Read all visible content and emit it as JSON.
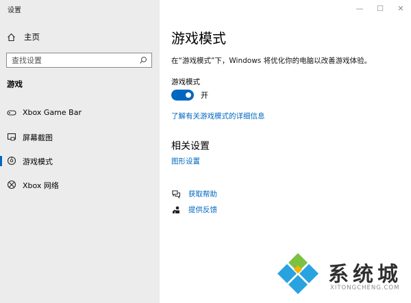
{
  "window": {
    "title": "设置",
    "controls": {
      "minimize": "—",
      "maximize": "☐",
      "close": "✕"
    }
  },
  "sidebar": {
    "home_label": "主页",
    "search_placeholder": "查找设置",
    "section_title": "游戏",
    "items": [
      {
        "label": "Xbox Game Bar",
        "icon": "xbox-game-bar-icon"
      },
      {
        "label": "屏幕截图",
        "icon": "screenshot-icon"
      },
      {
        "label": "游戏模式",
        "icon": "game-mode-icon",
        "active": true
      },
      {
        "label": "Xbox 网络",
        "icon": "xbox-icon"
      }
    ]
  },
  "main": {
    "title": "游戏模式",
    "description": "在“游戏模式”下，Windows 将优化你的电脑以改善游戏体验。",
    "toggle_title": "游戏模式",
    "toggle_state": "开",
    "toggle_on": true,
    "learn_more_link": "了解有关游戏模式的详细信息",
    "related_title": "相关设置",
    "graphics_link": "图形设置",
    "help": [
      {
        "label": "获取帮助",
        "icon": "help-chat-icon"
      },
      {
        "label": "提供反馈",
        "icon": "feedback-icon"
      }
    ]
  },
  "watermark": {
    "brand": "系统城",
    "url": "XITONGCHENG.COM"
  },
  "colors": {
    "accent": "#0067c0",
    "sidebar_bg": "#ececec"
  }
}
